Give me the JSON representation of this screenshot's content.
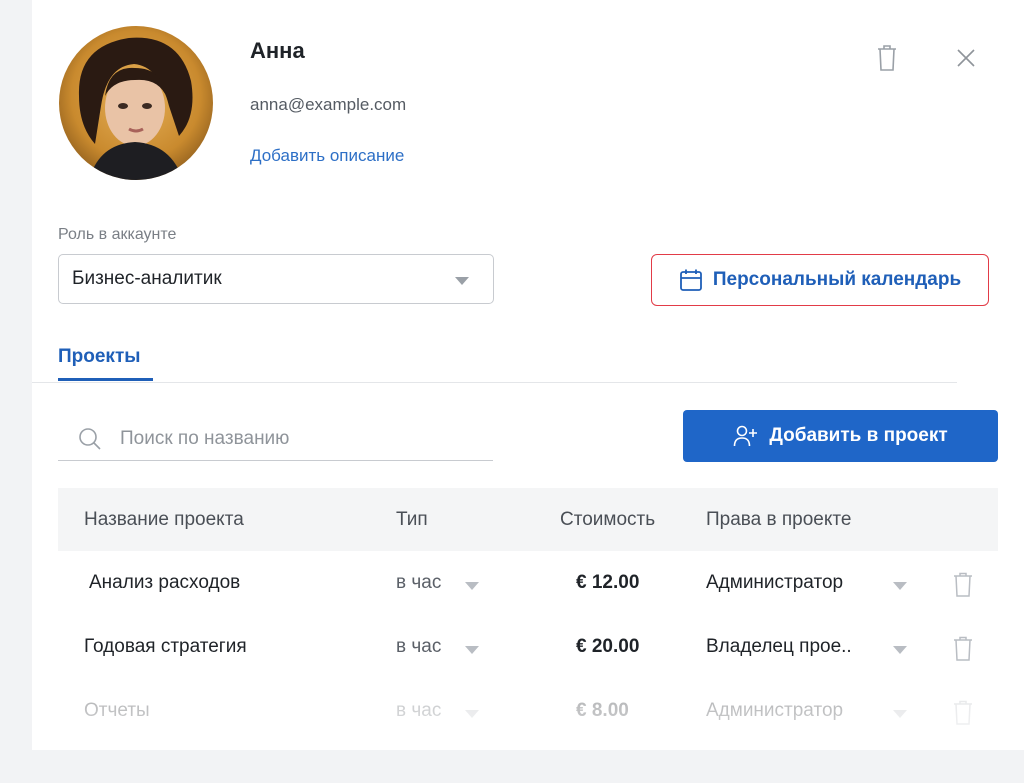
{
  "user": {
    "name": "Анна",
    "email": "anna@example.com",
    "add_description": "Добавить описание"
  },
  "role": {
    "label": "Роль в аккаунте",
    "selected": "Бизнес-аналитик"
  },
  "calendar_button": "Персональный календарь",
  "tabs": [
    {
      "label": "Проекты",
      "active": true
    }
  ],
  "search": {
    "placeholder": "Поиск по названию",
    "value": ""
  },
  "add_to_project": "Добавить в проект",
  "table": {
    "columns": [
      "Название проекта",
      "Тип",
      "Стоимость",
      "Права в проекте"
    ],
    "rows": [
      {
        "name": "Анализ расходов",
        "type": "в час",
        "cost": "€ 12.00",
        "rights": "Администратор"
      },
      {
        "name": "Годовая стратегия",
        "type": "в час",
        "cost": "€ 20.00",
        "rights": "Владелец прое.."
      },
      {
        "name": "Отчеты",
        "type": "в час",
        "cost": "€ 8.00",
        "rights": "Администратор"
      }
    ]
  },
  "colors": {
    "accent": "#1f66c8",
    "link": "#2d6fc6",
    "calendar_border": "#e23b47"
  },
  "icons": [
    "trash-icon",
    "close-icon",
    "calendar-icon",
    "search-icon",
    "add-user-icon",
    "chevron-down-icon"
  ]
}
